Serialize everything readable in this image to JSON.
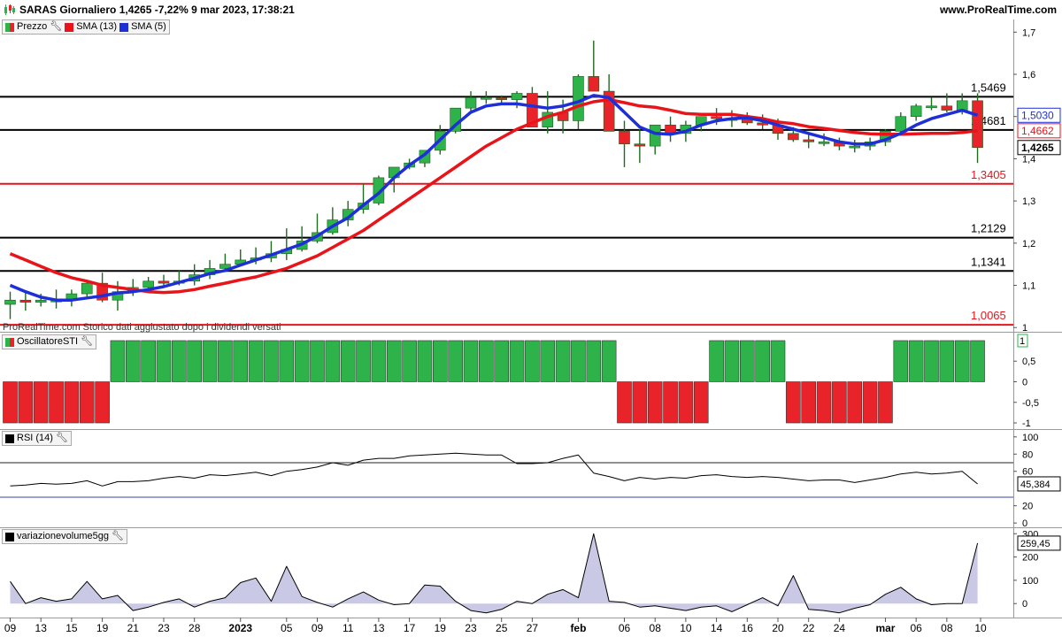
{
  "header": {
    "title": "SARAS Giornaliero 1,4265 -7,22% 9 mar 2023, 17:38:21",
    "brand": "www.ProRealTime.com"
  },
  "legends": {
    "price": "Prezzo",
    "sma13": "SMA (13)",
    "sma5": "SMA (5)",
    "sti": "OscillatoreSTI",
    "rsi": "RSI (14)",
    "vol": "variazionevolume5gg"
  },
  "note": "ProRealTime.com Storico dati aggiustato dopo i dividendi versati",
  "colors": {
    "up": "#2db34a",
    "down": "#e8242a",
    "sma13": "#e8141a",
    "sma5": "#1f2fd8",
    "vol_fill": "#c9c9e6"
  },
  "chart_data": [
    {
      "type": "candlestick",
      "name": "price",
      "x": [
        "2022-12-09",
        "2022-12-12",
        "2022-12-13",
        "2022-12-14",
        "2022-12-15",
        "2022-12-16",
        "2022-12-19",
        "2022-12-20",
        "2022-12-21",
        "2022-12-22",
        "2022-12-23",
        "2022-12-27",
        "2022-12-28",
        "2022-12-29",
        "2022-12-30",
        "2023-01-02",
        "2023-01-03",
        "2023-01-04",
        "2023-01-05",
        "2023-01-06",
        "2023-01-09",
        "2023-01-10",
        "2023-01-11",
        "2023-01-12",
        "2023-01-13",
        "2023-01-16",
        "2023-01-17",
        "2023-01-18",
        "2023-01-19",
        "2023-01-20",
        "2023-01-23",
        "2023-01-24",
        "2023-01-25",
        "2023-01-26",
        "2023-01-27",
        "2023-01-30",
        "2023-01-31",
        "2023-02-01",
        "2023-02-02",
        "2023-02-03",
        "2023-02-06",
        "2023-02-07",
        "2023-02-08",
        "2023-02-09",
        "2023-02-10",
        "2023-02-13",
        "2023-02-14",
        "2023-02-15",
        "2023-02-16",
        "2023-02-17",
        "2023-02-20",
        "2023-02-21",
        "2023-02-22",
        "2023-02-23",
        "2023-02-24",
        "2023-02-27",
        "2023-02-28",
        "2023-03-01",
        "2023-03-02",
        "2023-03-03",
        "2023-03-06",
        "2023-03-07",
        "2023-03-08",
        "2023-03-09"
      ],
      "open": [
        1.055,
        1.065,
        1.06,
        1.065,
        1.065,
        1.08,
        1.105,
        1.065,
        1.085,
        1.095,
        1.11,
        1.105,
        1.11,
        1.125,
        1.14,
        1.15,
        1.16,
        1.165,
        1.175,
        1.185,
        1.205,
        1.225,
        1.255,
        1.28,
        1.295,
        1.355,
        1.38,
        1.39,
        1.42,
        1.465,
        1.52,
        1.545,
        1.545,
        1.54,
        1.555,
        1.475,
        1.51,
        1.49,
        1.595,
        1.56,
        1.465,
        1.435,
        1.43,
        1.48,
        1.46,
        1.48,
        1.5,
        1.495,
        1.495,
        1.485,
        1.48,
        1.46,
        1.445,
        1.44,
        1.44,
        1.43,
        1.43,
        1.44,
        1.465,
        1.5,
        1.525,
        1.525,
        1.515,
        1.5375
      ],
      "high": [
        1.085,
        1.085,
        1.08,
        1.09,
        1.09,
        1.11,
        1.13,
        1.11,
        1.115,
        1.12,
        1.125,
        1.135,
        1.15,
        1.16,
        1.175,
        1.185,
        1.19,
        1.205,
        1.235,
        1.24,
        1.27,
        1.285,
        1.3,
        1.34,
        1.36,
        1.38,
        1.4,
        1.41,
        1.48,
        1.52,
        1.56,
        1.56,
        1.55,
        1.56,
        1.57,
        1.56,
        1.54,
        1.6,
        1.68,
        1.6,
        1.49,
        1.47,
        1.46,
        1.5,
        1.49,
        1.5,
        1.52,
        1.515,
        1.51,
        1.505,
        1.495,
        1.475,
        1.46,
        1.46,
        1.45,
        1.445,
        1.45,
        1.47,
        1.51,
        1.53,
        1.545,
        1.555,
        1.555,
        1.555
      ],
      "low": [
        1.02,
        1.04,
        1.05,
        1.045,
        1.05,
        1.07,
        1.06,
        1.04,
        1.075,
        1.09,
        1.095,
        1.1,
        1.1,
        1.115,
        1.135,
        1.145,
        1.15,
        1.155,
        1.16,
        1.18,
        1.2,
        1.22,
        1.24,
        1.27,
        1.29,
        1.32,
        1.375,
        1.38,
        1.41,
        1.46,
        1.51,
        1.53,
        1.53,
        1.52,
        1.475,
        1.46,
        1.46,
        1.47,
        1.58,
        1.48,
        1.38,
        1.39,
        1.41,
        1.44,
        1.44,
        1.465,
        1.48,
        1.475,
        1.48,
        1.47,
        1.445,
        1.44,
        1.425,
        1.43,
        1.42,
        1.415,
        1.42,
        1.43,
        1.46,
        1.49,
        1.515,
        1.51,
        1.505,
        1.39
      ],
      "close": [
        1.065,
        1.06,
        1.065,
        1.065,
        1.08,
        1.105,
        1.065,
        1.085,
        1.095,
        1.11,
        1.105,
        1.11,
        1.125,
        1.14,
        1.15,
        1.16,
        1.165,
        1.175,
        1.185,
        1.205,
        1.225,
        1.255,
        1.28,
        1.295,
        1.355,
        1.38,
        1.39,
        1.42,
        1.465,
        1.52,
        1.545,
        1.545,
        1.54,
        1.555,
        1.475,
        1.51,
        1.49,
        1.595,
        1.56,
        1.465,
        1.435,
        1.43,
        1.48,
        1.46,
        1.48,
        1.5,
        1.495,
        1.495,
        1.485,
        1.48,
        1.46,
        1.445,
        1.44,
        1.44,
        1.43,
        1.43,
        1.44,
        1.465,
        1.5,
        1.525,
        1.525,
        1.515,
        1.5375,
        1.4265
      ],
      "sma13": [
        1.175,
        1.16,
        1.145,
        1.13,
        1.118,
        1.11,
        1.1,
        1.095,
        1.09,
        1.085,
        1.083,
        1.085,
        1.09,
        1.098,
        1.105,
        1.113,
        1.12,
        1.13,
        1.14,
        1.155,
        1.17,
        1.19,
        1.21,
        1.23,
        1.255,
        1.28,
        1.305,
        1.33,
        1.355,
        1.38,
        1.405,
        1.43,
        1.45,
        1.47,
        1.485,
        1.5,
        1.51,
        1.525,
        1.535,
        1.54,
        1.533,
        1.525,
        1.522,
        1.515,
        1.507,
        1.505,
        1.505,
        1.505,
        1.5,
        1.495,
        1.487,
        1.483,
        1.476,
        1.472,
        1.467,
        1.462,
        1.459,
        1.458,
        1.458,
        1.459,
        1.46,
        1.46,
        1.462,
        1.4662
      ],
      "sma5": [
        1.1,
        1.085,
        1.072,
        1.065,
        1.065,
        1.07,
        1.075,
        1.082,
        1.085,
        1.09,
        1.097,
        1.107,
        1.117,
        1.128,
        1.135,
        1.148,
        1.16,
        1.172,
        1.185,
        1.198,
        1.217,
        1.24,
        1.26,
        1.29,
        1.318,
        1.355,
        1.385,
        1.41,
        1.445,
        1.48,
        1.51,
        1.525,
        1.53,
        1.53,
        1.525,
        1.52,
        1.525,
        1.535,
        1.55,
        1.545,
        1.51,
        1.475,
        1.46,
        1.458,
        1.465,
        1.48,
        1.49,
        1.495,
        1.497,
        1.49,
        1.48,
        1.47,
        1.46,
        1.45,
        1.44,
        1.435,
        1.435,
        1.445,
        1.46,
        1.48,
        1.495,
        1.505,
        1.515,
        1.503
      ],
      "price_labels": [
        "1,5469",
        "1,4681",
        "1,3405",
        "1,2129",
        "1,1341",
        "1,0065"
      ],
      "levels": [
        1.5469,
        1.4681,
        1.3405,
        1.2129,
        1.1341,
        1.0065
      ],
      "level_colors": [
        "#000",
        "#000",
        "#e8141a",
        "#000",
        "#000",
        "#e8141a"
      ],
      "ylim": [
        0.99,
        1.73
      ],
      "yticks": [
        1,
        1.1,
        1.2,
        1.3,
        1.4,
        1.5,
        1.6,
        1.7
      ],
      "ytick_labels": [
        "1",
        "1,1",
        "1,2",
        "1,3",
        "1,4",
        "1,5",
        "1,6",
        "1,7"
      ],
      "last_sma5_label": "1,5030",
      "last_sma13_label": "1,4662",
      "last_price_label": "1,4265"
    },
    {
      "type": "bar",
      "name": "sti",
      "values": [
        -1,
        -1,
        -1,
        -1,
        -1,
        -1,
        -1,
        1,
        1,
        1,
        1,
        1,
        1,
        1,
        1,
        1,
        1,
        1,
        1,
        1,
        1,
        1,
        1,
        1,
        1,
        1,
        1,
        1,
        1,
        1,
        1,
        1,
        1,
        1,
        1,
        1,
        1,
        1,
        1,
        1,
        -1,
        -1,
        -1,
        -1,
        -1,
        -1,
        1,
        1,
        1,
        1,
        1,
        -1,
        -1,
        -1,
        -1,
        -1,
        -1,
        -1,
        1,
        1,
        1,
        1,
        1,
        1
      ],
      "ylim": [
        -1.15,
        1.15
      ],
      "ytick_labels": [
        "0,5",
        "0",
        "-0,5",
        "-1"
      ],
      "yticks": [
        0.5,
        0,
        -0.5,
        -1
      ],
      "last_label": "1"
    },
    {
      "type": "line",
      "name": "rsi",
      "values": [
        43,
        44,
        46,
        45,
        46,
        49,
        43,
        48,
        48,
        49,
        52,
        54,
        52,
        56,
        55,
        57,
        59,
        55,
        60,
        62,
        65,
        70,
        67,
        73,
        75,
        75,
        78,
        79,
        80,
        81,
        80,
        79,
        79,
        69,
        69,
        70,
        75,
        79,
        58,
        54,
        49,
        53,
        51,
        53,
        52,
        55,
        56,
        54,
        53,
        54,
        53,
        51,
        49,
        50,
        50,
        47,
        50,
        53,
        57,
        59,
        57,
        58,
        60,
        45.384
      ],
      "ylim": [
        -5,
        107
      ],
      "yticks": [
        100,
        80,
        60,
        20,
        0
      ],
      "ytick_labels": [
        "100",
        "80",
        "60",
        "20",
        "0"
      ],
      "bands": [
        70,
        30
      ],
      "last_label": "45,384"
    },
    {
      "type": "area",
      "name": "vol",
      "values": [
        95,
        0,
        25,
        10,
        20,
        95,
        20,
        35,
        -30,
        -15,
        5,
        20,
        -15,
        10,
        25,
        90,
        110,
        10,
        160,
        30,
        5,
        -15,
        20,
        50,
        15,
        -5,
        0,
        80,
        75,
        10,
        -30,
        -40,
        -25,
        10,
        0,
        40,
        60,
        25,
        300,
        10,
        5,
        -15,
        -10,
        -20,
        -30,
        -15,
        -10,
        -35,
        -5,
        25,
        -10,
        120,
        -25,
        -30,
        -40,
        -20,
        -5,
        40,
        70,
        20,
        -5,
        0,
        0,
        259.45
      ],
      "ylim": [
        -60,
        320
      ],
      "yticks": [
        300,
        200,
        100,
        0
      ],
      "ytick_labels": [
        "300",
        "200",
        "100",
        "0"
      ],
      "last_label": "259,45"
    },
    {
      "type": "axis",
      "name": "xaxis",
      "tick_labels": [
        "09",
        "13",
        "15",
        "19",
        "21",
        "23",
        "28",
        "2023",
        "05",
        "09",
        "11",
        "13",
        "17",
        "19",
        "23",
        "25",
        "27",
        "feb",
        "06",
        "08",
        "10",
        "14",
        "16",
        "20",
        "22",
        "24",
        "mar",
        "06",
        "08",
        "10"
      ],
      "tick_index": [
        0,
        2,
        4,
        6,
        8,
        10,
        12,
        15,
        18,
        20,
        22,
        24,
        26,
        28,
        30,
        32,
        34,
        37,
        40,
        42,
        44,
        46,
        48,
        50,
        52,
        54,
        57,
        59,
        61,
        63.2
      ],
      "bold_labels": [
        "2023",
        "feb",
        "mar"
      ]
    }
  ]
}
